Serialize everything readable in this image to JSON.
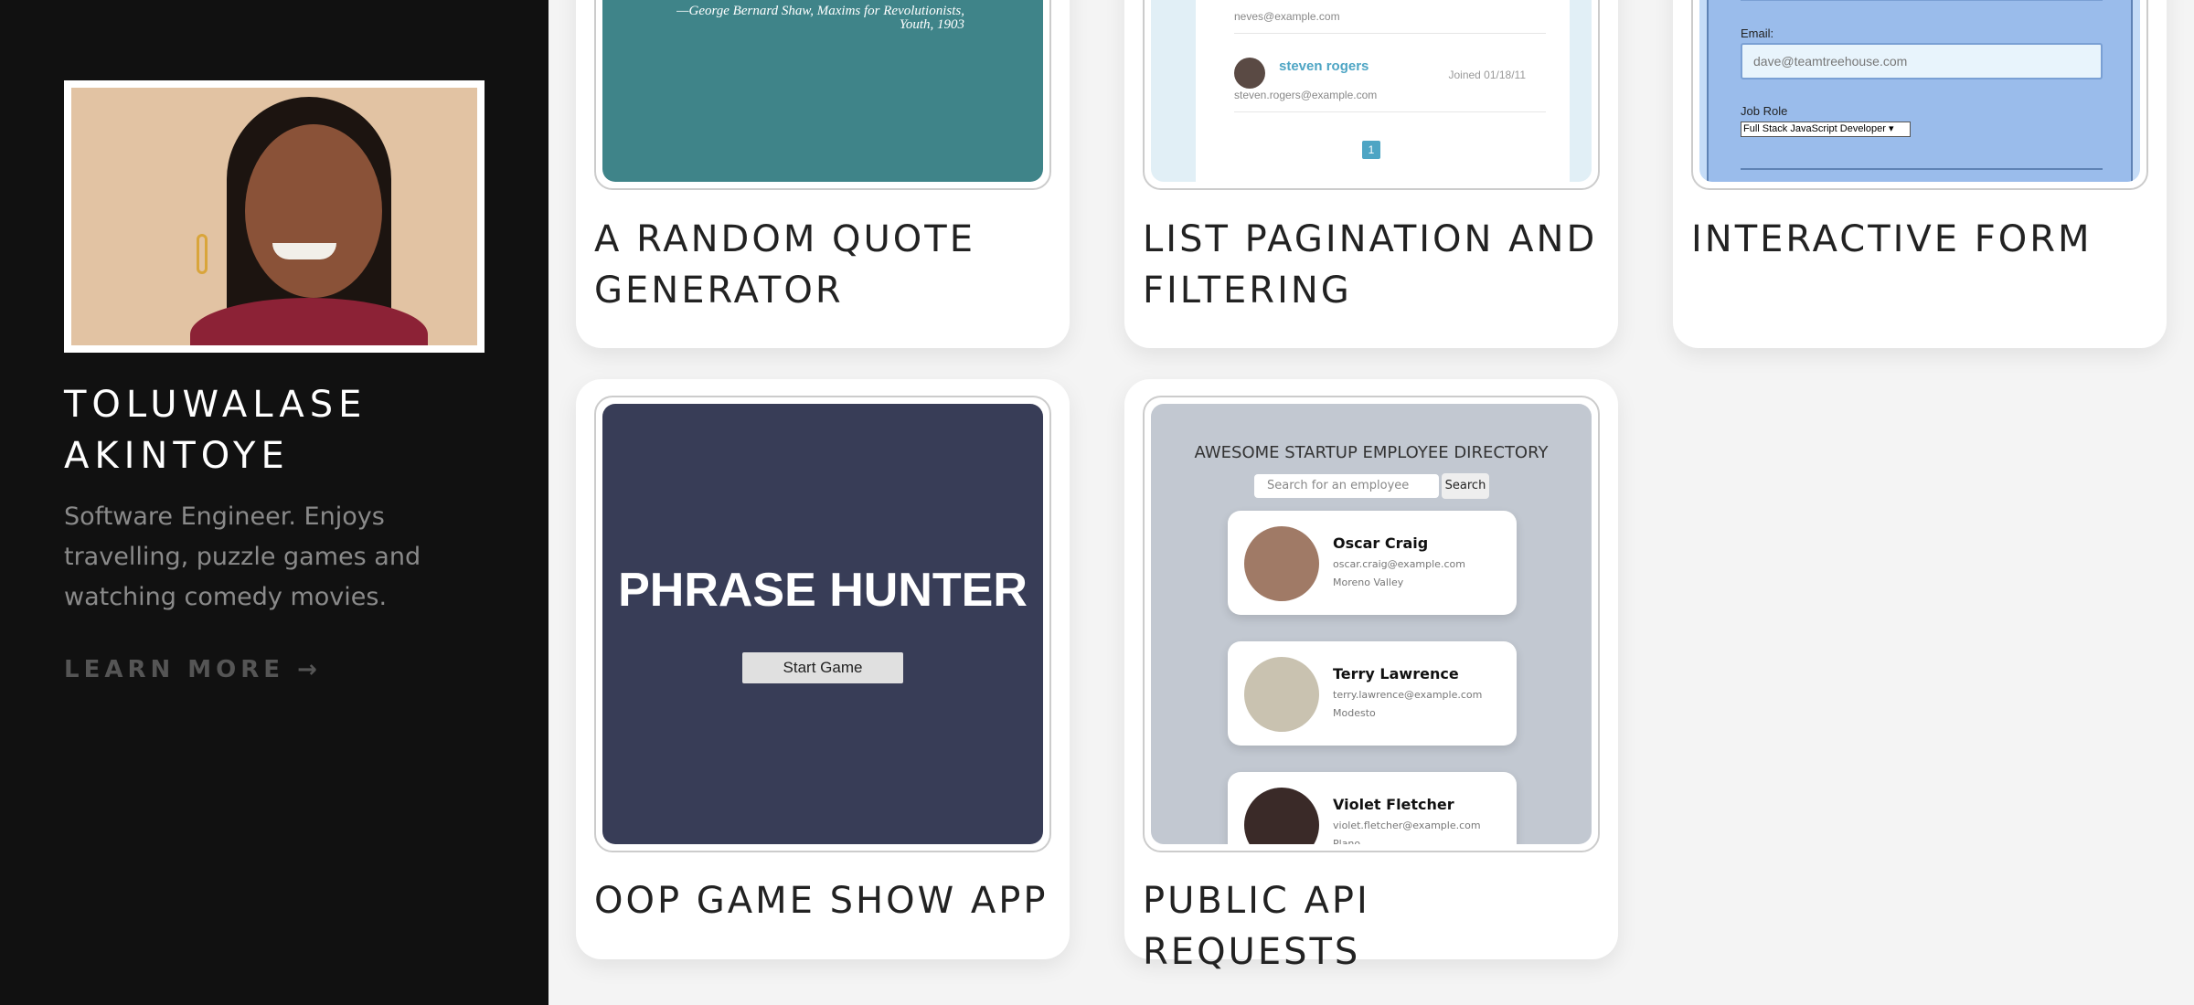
{
  "profile": {
    "name": "TOLUWALASE AKINTOYE",
    "bio": "Software Engineer. Enjoys travelling, puzzle games and watching comedy movies.",
    "learn_more": "LEARN MORE →"
  },
  "projects": [
    {
      "title": "A RANDOM QUOTE GENERATOR",
      "preview": {
        "quote_attribution": "—George Bernard Shaw, Maxims for Revolutionists,",
        "quote_year": "Youth, 1903",
        "bg": "#3f8489"
      }
    },
    {
      "title": "LIST PAGINATION AND FILTERING",
      "preview": {
        "prev_email": "neves@example.com",
        "student_name": "steven rogers",
        "student_email": "steven.rogers@example.com",
        "joined": "Joined 01/18/11",
        "page": "1"
      }
    },
    {
      "title": "INTERACTIVE FORM",
      "preview": {
        "email_label": "Email:",
        "email_placeholder": "dave@teamtreehouse.com",
        "job_label": "Job Role",
        "job_value": "Full Stack JavaScript Developer",
        "bg": "#9abceb"
      }
    },
    {
      "title": "OOP GAME SHOW APP",
      "preview": {
        "heading": "PHRASE HUNTER",
        "button": "Start Game",
        "bg": "#383d57"
      }
    },
    {
      "title": "PUBLIC API REQUESTS",
      "preview": {
        "heading": "AWESOME STARTUP EMPLOYEE DIRECTORY",
        "search_placeholder": "Search for an employee",
        "search_button": "Search",
        "employees": [
          {
            "name": "Oscar Craig",
            "email": "oscar.craig@example.com",
            "city": "Moreno Valley"
          },
          {
            "name": "Terry Lawrence",
            "email": "terry.lawrence@example.com",
            "city": "Modesto"
          },
          {
            "name": "Violet Fletcher",
            "email": "violet.fletcher@example.com",
            "city": "Plano"
          }
        ],
        "bg": "#c2c8d1"
      }
    }
  ]
}
